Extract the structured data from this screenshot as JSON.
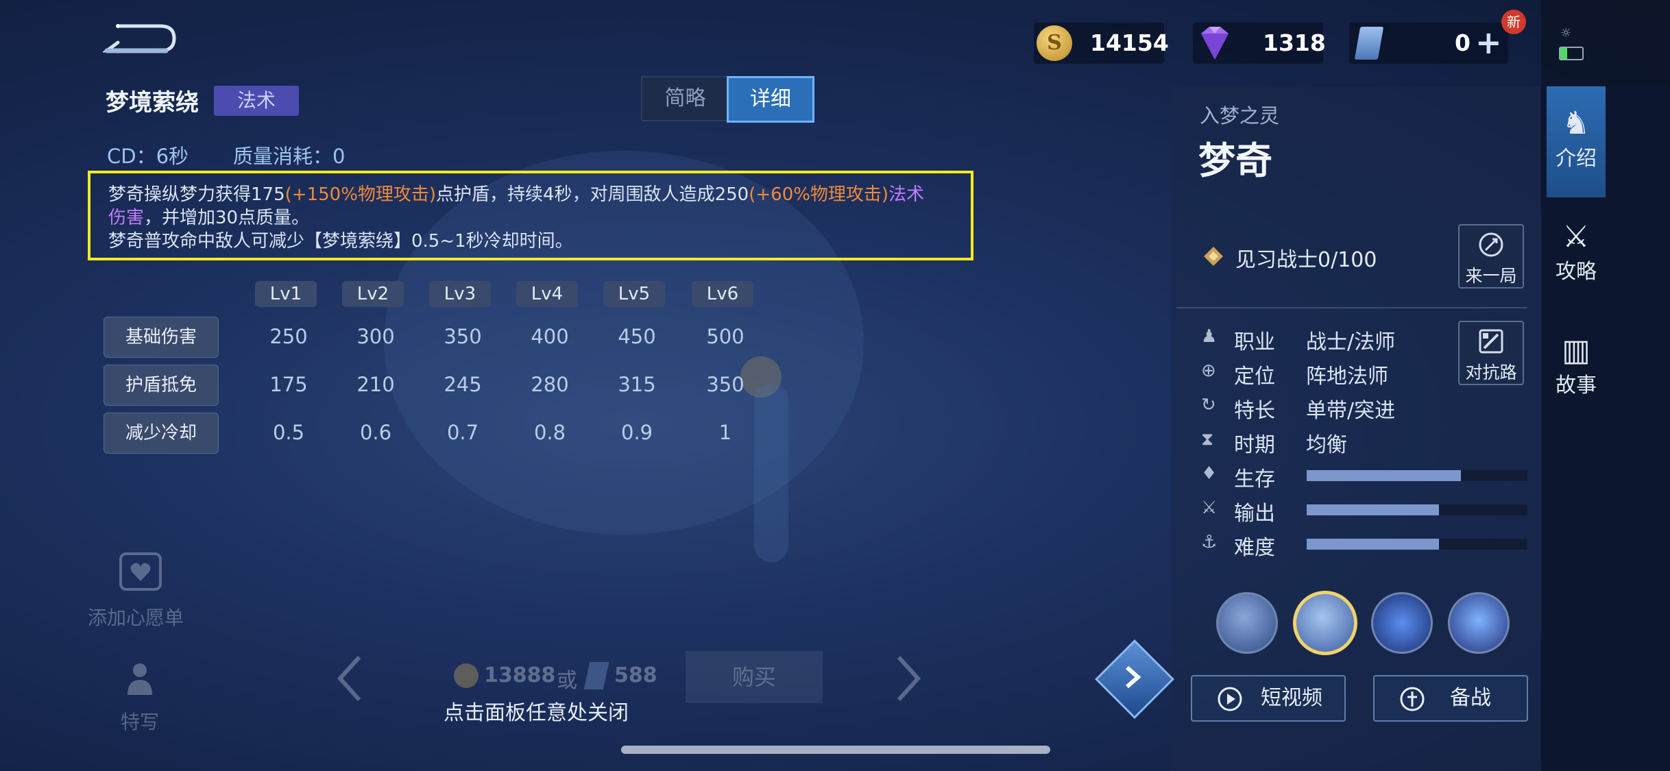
{
  "skill": {
    "name": "梦境萦绕",
    "type_tag": "法术",
    "tabs": [
      "简略",
      "详细"
    ],
    "cd": "CD：6秒",
    "cost": "质量消耗：0",
    "desc_parts": [
      "梦奇操纵梦力获得175",
      "(+150%物理攻击)",
      "点护盾，持续4秒，对周围敌人造成250",
      "(+60%物理攻击)",
      "法术",
      "伤害",
      "，并增加30点质量。",
      "梦奇普攻命中敌人可减少【梦境萦绕】0.5~1秒冷却时间。"
    ]
  },
  "levels": [
    "Lv1",
    "Lv2",
    "Lv3",
    "Lv4",
    "Lv5",
    "Lv6"
  ],
  "table": [
    {
      "label": "基础伤害",
      "values": [
        "250",
        "300",
        "350",
        "400",
        "450",
        "500"
      ]
    },
    {
      "label": "护盾抵免",
      "values": [
        "175",
        "210",
        "245",
        "280",
        "315",
        "350"
      ]
    },
    {
      "label": "减少冷却",
      "values": [
        "0.5",
        "0.6",
        "0.7",
        "0.8",
        "0.9",
        "1"
      ]
    }
  ],
  "currency": {
    "gold": "14154",
    "diamond": "1318",
    "ticket": "0",
    "new_badge": "新"
  },
  "hero": {
    "subtitle": "入梦之灵",
    "name": "梦奇",
    "rank": "见习战士0/100",
    "play_button": "来一局",
    "lane_button": "对抗路",
    "attributes": [
      {
        "key": "职业",
        "value": "战士/法师"
      },
      {
        "key": "定位",
        "value": "阵地法师"
      },
      {
        "key": "特长",
        "value": "单带/突进"
      },
      {
        "key": "时期",
        "value": "均衡"
      }
    ],
    "stats": [
      {
        "key": "生存",
        "level": 0.7
      },
      {
        "key": "输出",
        "level": 0.6
      },
      {
        "key": "难度",
        "level": 0.6
      }
    ],
    "video_button": "短视频",
    "prep_button": "备战"
  },
  "sidebar": [
    "介绍",
    "攻略",
    "故事"
  ],
  "bottom": {
    "wishlist": "添加心愿单",
    "closeup": "特写",
    "price_gold": "13888",
    "price_or": "或",
    "price_ticket": "588",
    "buy": "购买",
    "close_hint": "点击面板任意处关闭"
  },
  "colors": {
    "highlight_border": "#f4ea1e",
    "orange": "#f08a3a",
    "purple": "#c37cff",
    "accent_blue": "#2a6fb8"
  }
}
